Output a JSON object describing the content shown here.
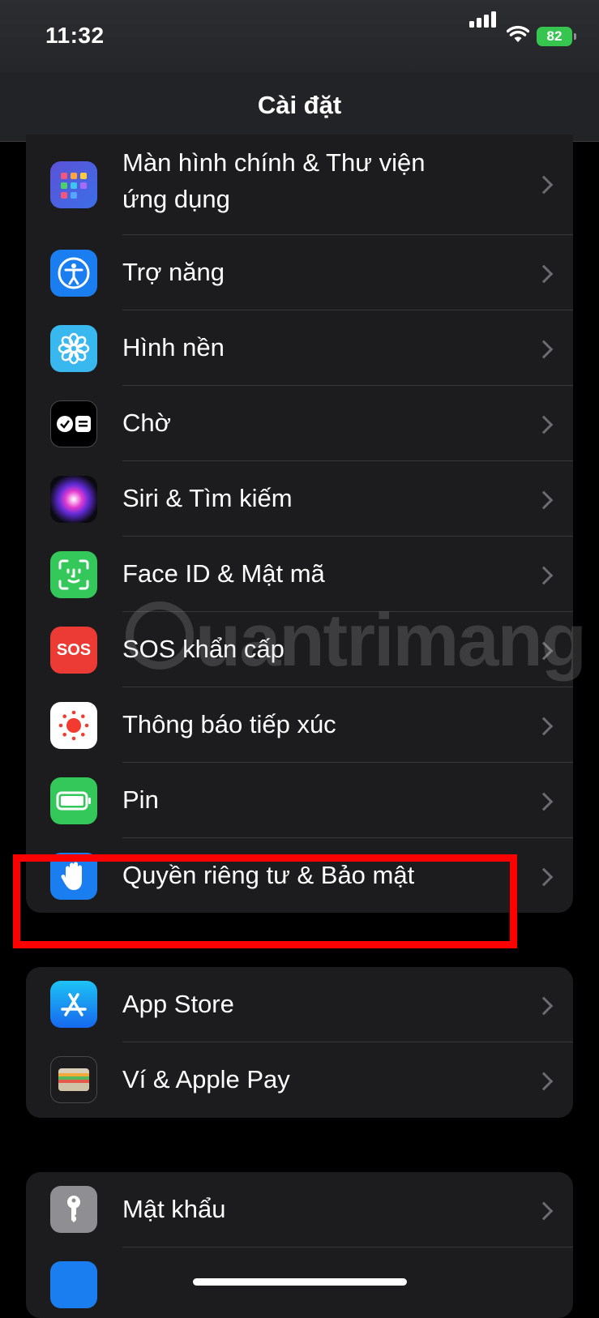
{
  "status": {
    "time": "11:32",
    "battery": "82"
  },
  "nav": {
    "title": "Cài đặt"
  },
  "group1": [
    {
      "label_line1": "Màn hình chính & Thư viện",
      "label_line2": "ứng dụng",
      "icon": "home-screen-grid-icon"
    },
    {
      "label": "Trợ năng",
      "icon": "accessibility-icon"
    },
    {
      "label": "Hình nền",
      "icon": "wallpaper-flower-icon"
    },
    {
      "label": "Chờ",
      "icon": "standby-icon"
    },
    {
      "label": "Siri & Tìm kiếm",
      "icon": "siri-icon"
    },
    {
      "label": "Face ID & Mật mã",
      "icon": "face-id-icon"
    },
    {
      "label": "SOS khẩn cấp",
      "icon": "sos-icon",
      "icon_text": "SOS"
    },
    {
      "label": "Thông báo tiếp xúc",
      "icon": "exposure-notification-icon"
    },
    {
      "label": "Pin",
      "icon": "battery-icon"
    },
    {
      "label": "Quyền riêng tư & Bảo mật",
      "icon": "privacy-hand-icon"
    }
  ],
  "group2": [
    {
      "label": "App Store",
      "icon": "app-store-icon"
    },
    {
      "label": "Ví & Apple Pay",
      "icon": "wallet-icon"
    }
  ],
  "group3": [
    {
      "label": "Mật khẩu",
      "icon": "key-icon"
    }
  ],
  "watermark": "uantrimang",
  "colors": {
    "highlight": "#ff0000",
    "battery": "#36c64f",
    "background": "#000000",
    "group": "#1c1c1e"
  }
}
